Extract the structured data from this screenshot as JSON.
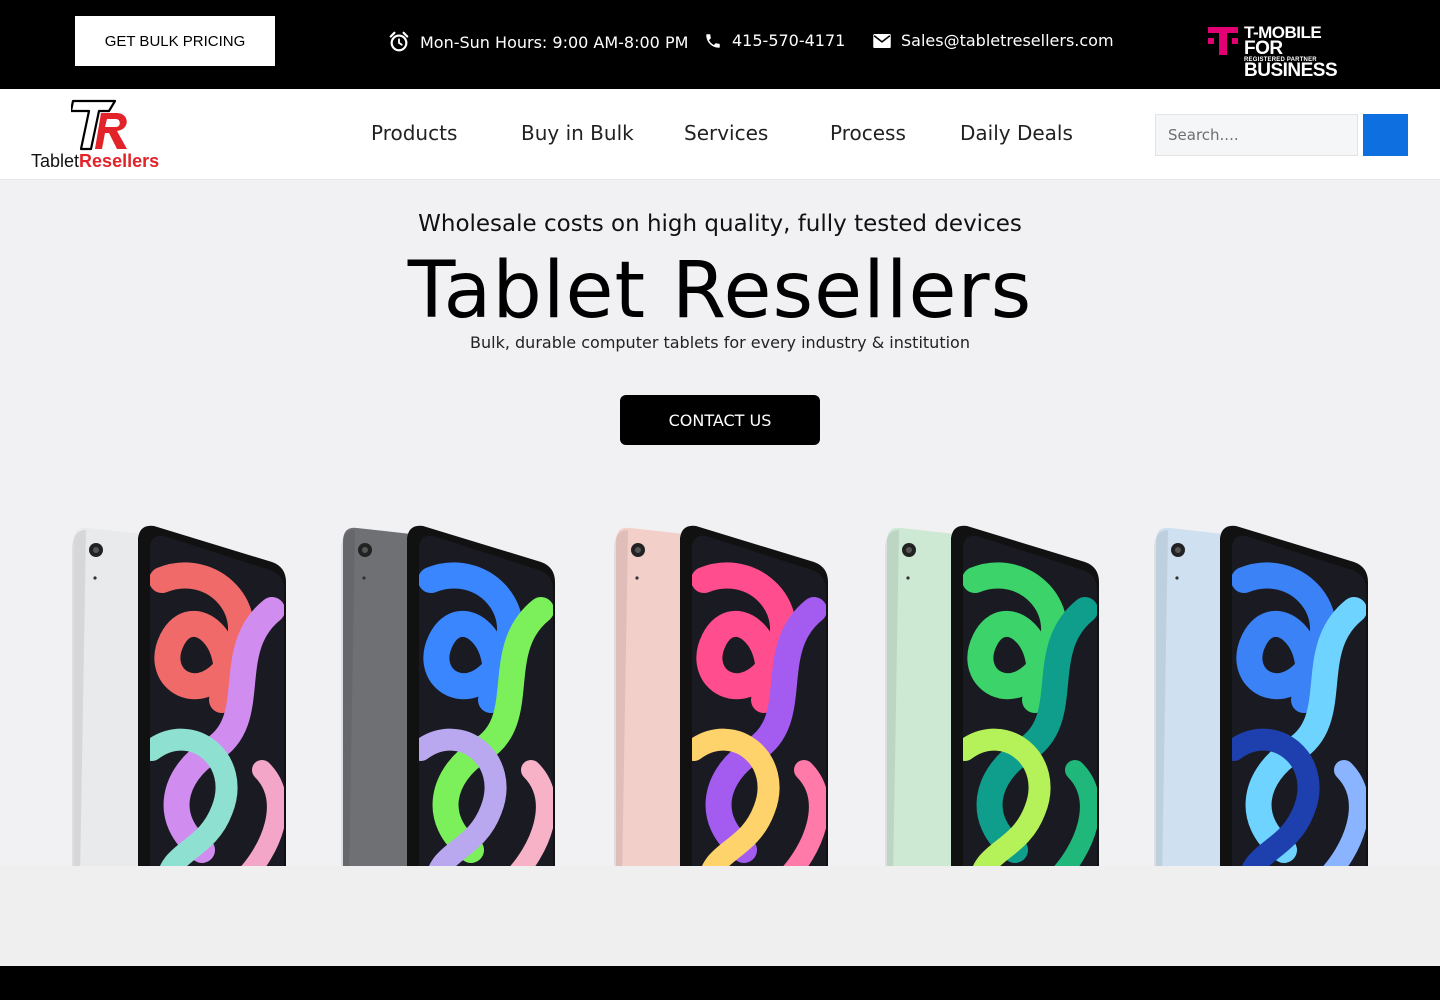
{
  "topbar": {
    "bulk_button": "GET BULK PRICING",
    "hours": "Mon-Sun Hours: 9:00 AM-8:00 PM",
    "phone": "415-570-4171",
    "email": "Sales@tabletresellers.com",
    "partner": {
      "line1": "T-MOBILE",
      "line2": "FOR BUSINESS",
      "line3": "REGISTERED PARTNER",
      "brand_color": "#e20074"
    }
  },
  "header": {
    "logo": {
      "part1": "Tablet",
      "part2": "Resellers",
      "accent": "#e2232a"
    },
    "nav": [
      "Products",
      "Buy in Bulk",
      "Services",
      "Process",
      "Daily Deals"
    ],
    "search": {
      "placeholder": "Search....",
      "button_color": "#0d6fe0"
    }
  },
  "hero": {
    "tagline": "Wholesale costs on high quality, fully tested devices",
    "title": "Tablet Resellers",
    "subtitle": "Bulk, durable computer tablets for every industry & institution",
    "cta": "CONTACT US"
  },
  "tablets": [
    {
      "color": "silver",
      "body": "#e9eaec",
      "art": [
        "#f06a6a",
        "#d18cf0",
        "#8ee0d0",
        "#f4a6c8"
      ]
    },
    {
      "color": "space gray",
      "body": "#6f7073",
      "art": [
        "#3a86ff",
        "#7cf05a",
        "#b9a7f0",
        "#f7b2c8"
      ]
    },
    {
      "color": "rose gold",
      "body": "#f2cfc9",
      "art": [
        "#ff4d8d",
        "#a45cf0",
        "#ffd36b",
        "#ff7aa8"
      ]
    },
    {
      "color": "green",
      "body": "#cde9d4",
      "art": [
        "#3bd36a",
        "#0f9e8c",
        "#b5f25a",
        "#1fb87a"
      ]
    },
    {
      "color": "sky blue",
      "body": "#cfe1f0",
      "art": [
        "#3b82f6",
        "#6fd3ff",
        "#1e40af",
        "#8ab4ff"
      ]
    }
  ]
}
